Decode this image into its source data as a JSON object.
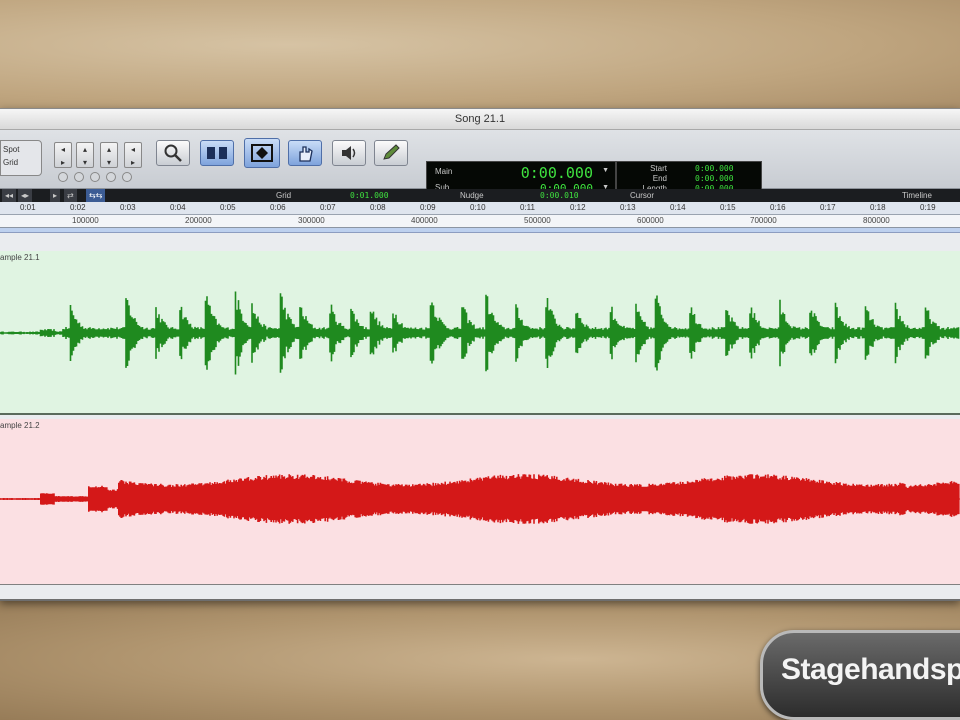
{
  "window": {
    "title": "Song 21.1"
  },
  "toolbar": {
    "mode_labels": [
      "Spot",
      "Grid"
    ],
    "tools": [
      "zoom-tool",
      "trim-tool",
      "selector-tool",
      "grabber-tool",
      "scrubber-tool",
      "pencil-tool"
    ],
    "active_tool": "selector-tool"
  },
  "counter": {
    "main_label": "Main",
    "main_value": "0:00.000",
    "sub_label": "Sub",
    "sub_value": "0:00.000"
  },
  "selection": {
    "start_label": "Start",
    "start_value": "0:00.000",
    "end_label": "End",
    "end_value": "0:00.000",
    "length_label": "Length",
    "length_value": "0:00.000"
  },
  "rulers": {
    "grid_label": "Grid",
    "grid_value": "0:01.000",
    "nudge_label": "Nudge",
    "nudge_value": "0:00.010",
    "cursor_label": "Cursor",
    "timeline_label": "Timeline",
    "minutes_ticks": [
      "0:01",
      "0:02",
      "0:03",
      "0:04",
      "0:05",
      "0:06",
      "0:07",
      "0:08",
      "0:09",
      "0:10",
      "0:11",
      "0:12",
      "0:13",
      "0:14",
      "0:15",
      "0:16",
      "0:17",
      "0:18",
      "0:19"
    ],
    "samples_ticks": [
      "100000",
      "200000",
      "300000",
      "400000",
      "500000",
      "600000",
      "700000",
      "800000"
    ]
  },
  "tracks": [
    {
      "name": "ample 21.1",
      "color": "#1f8a1f",
      "background": "#e0f4e2"
    },
    {
      "name": "ample 21.2",
      "color": "#d41818",
      "background": "#fbe0e3"
    }
  ],
  "watermark": {
    "text": "Stagehandspa"
  },
  "colors": {
    "counter_green": "#3fe23f",
    "selector_blue": "#7ea3dc"
  }
}
